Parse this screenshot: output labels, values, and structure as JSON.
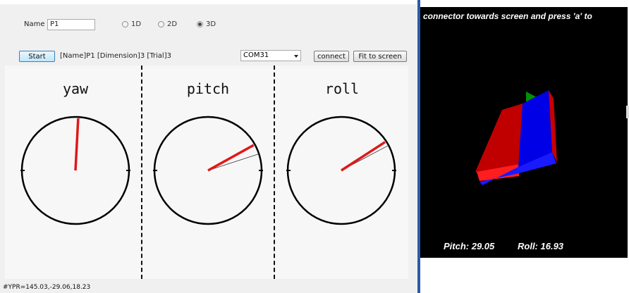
{
  "form": {
    "name_label": "Name",
    "name_value": "P1",
    "radios": [
      {
        "label": "1D",
        "checked": false
      },
      {
        "label": "2D",
        "checked": false
      },
      {
        "label": "3D",
        "checked": true
      }
    ],
    "start_label": "Start",
    "info_text": "[Name]P1  [Dimension]3  [Trial]3",
    "com_port": "COM31",
    "connect_label": "connect",
    "fit_label": "Fit to screen"
  },
  "gauges": [
    {
      "title": "yaw",
      "angle_deg": 87,
      "secondary_deg": 86
    },
    {
      "title": "pitch",
      "angle_deg": 29.05,
      "secondary_deg": 18
    },
    {
      "title": "roll",
      "angle_deg": 33,
      "secondary_deg": 28
    }
  ],
  "status_text": "#YPR=145.03,-29.06,18.23",
  "viewer": {
    "banner": "connector towards screen and press 'a' to",
    "pitch_text": "Pitch: 29.05",
    "roll_text": "Roll: 16.93"
  },
  "colors": {
    "needle": "#e01818",
    "board_red": "#c80000",
    "board_blue": "#0000e0",
    "board_green": "#00a000"
  }
}
